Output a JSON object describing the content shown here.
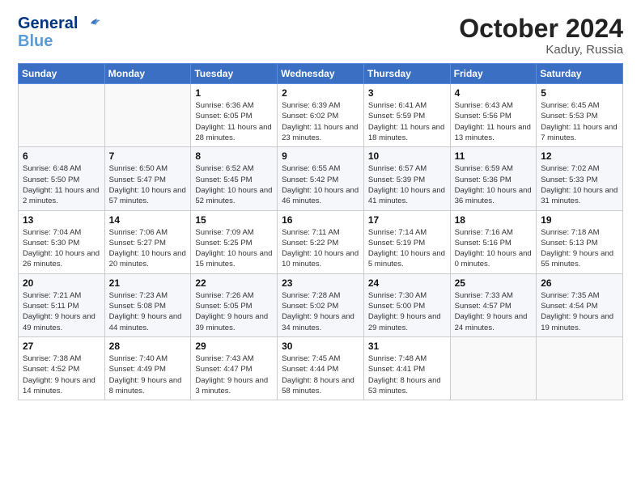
{
  "header": {
    "logo_line1": "General",
    "logo_line2": "Blue",
    "month_year": "October 2024",
    "location": "Kaduy, Russia"
  },
  "weekdays": [
    "Sunday",
    "Monday",
    "Tuesday",
    "Wednesday",
    "Thursday",
    "Friday",
    "Saturday"
  ],
  "weeks": [
    [
      {
        "day": "",
        "info": ""
      },
      {
        "day": "",
        "info": ""
      },
      {
        "day": "1",
        "info": "Sunrise: 6:36 AM\nSunset: 6:05 PM\nDaylight: 11 hours\nand 28 minutes."
      },
      {
        "day": "2",
        "info": "Sunrise: 6:39 AM\nSunset: 6:02 PM\nDaylight: 11 hours\nand 23 minutes."
      },
      {
        "day": "3",
        "info": "Sunrise: 6:41 AM\nSunset: 5:59 PM\nDaylight: 11 hours\nand 18 minutes."
      },
      {
        "day": "4",
        "info": "Sunrise: 6:43 AM\nSunset: 5:56 PM\nDaylight: 11 hours\nand 13 minutes."
      },
      {
        "day": "5",
        "info": "Sunrise: 6:45 AM\nSunset: 5:53 PM\nDaylight: 11 hours\nand 7 minutes."
      }
    ],
    [
      {
        "day": "6",
        "info": "Sunrise: 6:48 AM\nSunset: 5:50 PM\nDaylight: 11 hours\nand 2 minutes."
      },
      {
        "day": "7",
        "info": "Sunrise: 6:50 AM\nSunset: 5:47 PM\nDaylight: 10 hours\nand 57 minutes."
      },
      {
        "day": "8",
        "info": "Sunrise: 6:52 AM\nSunset: 5:45 PM\nDaylight: 10 hours\nand 52 minutes."
      },
      {
        "day": "9",
        "info": "Sunrise: 6:55 AM\nSunset: 5:42 PM\nDaylight: 10 hours\nand 46 minutes."
      },
      {
        "day": "10",
        "info": "Sunrise: 6:57 AM\nSunset: 5:39 PM\nDaylight: 10 hours\nand 41 minutes."
      },
      {
        "day": "11",
        "info": "Sunrise: 6:59 AM\nSunset: 5:36 PM\nDaylight: 10 hours\nand 36 minutes."
      },
      {
        "day": "12",
        "info": "Sunrise: 7:02 AM\nSunset: 5:33 PM\nDaylight: 10 hours\nand 31 minutes."
      }
    ],
    [
      {
        "day": "13",
        "info": "Sunrise: 7:04 AM\nSunset: 5:30 PM\nDaylight: 10 hours\nand 26 minutes."
      },
      {
        "day": "14",
        "info": "Sunrise: 7:06 AM\nSunset: 5:27 PM\nDaylight: 10 hours\nand 20 minutes."
      },
      {
        "day": "15",
        "info": "Sunrise: 7:09 AM\nSunset: 5:25 PM\nDaylight: 10 hours\nand 15 minutes."
      },
      {
        "day": "16",
        "info": "Sunrise: 7:11 AM\nSunset: 5:22 PM\nDaylight: 10 hours\nand 10 minutes."
      },
      {
        "day": "17",
        "info": "Sunrise: 7:14 AM\nSunset: 5:19 PM\nDaylight: 10 hours\nand 5 minutes."
      },
      {
        "day": "18",
        "info": "Sunrise: 7:16 AM\nSunset: 5:16 PM\nDaylight: 10 hours\nand 0 minutes."
      },
      {
        "day": "19",
        "info": "Sunrise: 7:18 AM\nSunset: 5:13 PM\nDaylight: 9 hours\nand 55 minutes."
      }
    ],
    [
      {
        "day": "20",
        "info": "Sunrise: 7:21 AM\nSunset: 5:11 PM\nDaylight: 9 hours\nand 49 minutes."
      },
      {
        "day": "21",
        "info": "Sunrise: 7:23 AM\nSunset: 5:08 PM\nDaylight: 9 hours\nand 44 minutes."
      },
      {
        "day": "22",
        "info": "Sunrise: 7:26 AM\nSunset: 5:05 PM\nDaylight: 9 hours\nand 39 minutes."
      },
      {
        "day": "23",
        "info": "Sunrise: 7:28 AM\nSunset: 5:02 PM\nDaylight: 9 hours\nand 34 minutes."
      },
      {
        "day": "24",
        "info": "Sunrise: 7:30 AM\nSunset: 5:00 PM\nDaylight: 9 hours\nand 29 minutes."
      },
      {
        "day": "25",
        "info": "Sunrise: 7:33 AM\nSunset: 4:57 PM\nDaylight: 9 hours\nand 24 minutes."
      },
      {
        "day": "26",
        "info": "Sunrise: 7:35 AM\nSunset: 4:54 PM\nDaylight: 9 hours\nand 19 minutes."
      }
    ],
    [
      {
        "day": "27",
        "info": "Sunrise: 7:38 AM\nSunset: 4:52 PM\nDaylight: 9 hours\nand 14 minutes."
      },
      {
        "day": "28",
        "info": "Sunrise: 7:40 AM\nSunset: 4:49 PM\nDaylight: 9 hours\nand 8 minutes."
      },
      {
        "day": "29",
        "info": "Sunrise: 7:43 AM\nSunset: 4:47 PM\nDaylight: 9 hours\nand 3 minutes."
      },
      {
        "day": "30",
        "info": "Sunrise: 7:45 AM\nSunset: 4:44 PM\nDaylight: 8 hours\nand 58 minutes."
      },
      {
        "day": "31",
        "info": "Sunrise: 7:48 AM\nSunset: 4:41 PM\nDaylight: 8 hours\nand 53 minutes."
      },
      {
        "day": "",
        "info": ""
      },
      {
        "day": "",
        "info": ""
      }
    ]
  ]
}
